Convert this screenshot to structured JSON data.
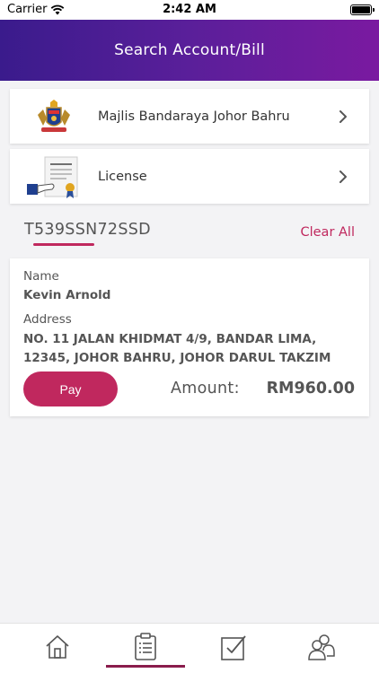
{
  "status_bar": {
    "carrier": "Carrier",
    "time": "2:42 AM"
  },
  "header": {
    "title": "Search Account/Bill"
  },
  "options": [
    {
      "label": "Majlis Bandaraya Johor Bahru",
      "icon": "mbjb-crest-icon"
    },
    {
      "label": "License",
      "icon": "license-certificate-icon"
    }
  ],
  "search": {
    "value": "T539SSN72SSD",
    "clear_label": "Clear All"
  },
  "bill": {
    "name_label": "Name",
    "name": "Kevin Arnold",
    "address_label": "Address",
    "address": "NO. 11 JALAN KHIDMAT 4/9, BANDAR LIMA, 12345, JOHOR BAHRU, JOHOR DARUL TAKZIM",
    "pay_label": "Pay",
    "amount_label": "Amount:",
    "amount": "RM960.00"
  },
  "tab_bar": {
    "tabs": [
      "home-icon",
      "bill-list-icon",
      "checkbox-icon",
      "community-icon"
    ],
    "active_index": 1
  },
  "colors": {
    "accent": "#c0285e",
    "header_start": "#3a1b8c",
    "header_end": "#7a1aa0"
  }
}
